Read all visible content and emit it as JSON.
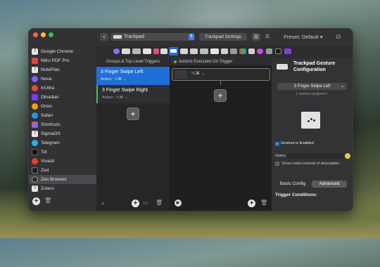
{
  "window": {
    "preset_label": "Preset: Default ▾"
  },
  "toolbar": {
    "back_label": "‹",
    "trigger_type": "Trackpad",
    "trackpad_settings_label": "Trackpad Settings"
  },
  "sidebar": {
    "items": [
      {
        "label": "Google Chrome",
        "color": "#4285f4"
      },
      {
        "label": "Nitro PDF Pro",
        "color": "#d94a3d"
      },
      {
        "label": "NotePlan",
        "color": "#f2f2f2"
      },
      {
        "label": "Nova",
        "color": "#8b5cf6"
      },
      {
        "label": "mUltra",
        "color": "#e5484d"
      },
      {
        "label": "Obsidian",
        "color": "#7c3aed"
      },
      {
        "label": "Orion",
        "color": "#f59e0b"
      },
      {
        "label": "Safari",
        "color": "#1d9bf0"
      },
      {
        "label": "Shortcuts",
        "color": "#ec4899"
      },
      {
        "label": "SigmaOS",
        "color": "#e5e5e5"
      },
      {
        "label": "Telegram",
        "color": "#2aabee"
      },
      {
        "label": "Tot",
        "color": "#111111"
      },
      {
        "label": "Vivaldi",
        "color": "#ef3939"
      },
      {
        "label": "Zed",
        "color": "#1f1f1f"
      },
      {
        "label": "Zen Browser",
        "color": "#2b2b2b"
      },
      {
        "label": "Zotero",
        "color": "#f2f2f2"
      }
    ]
  },
  "triggers": {
    "header": "Groups & Top Level Triggers",
    "items": [
      {
        "name": "3 Finger Swipe Left",
        "action": "Action: ⌥⌘ →"
      },
      {
        "name": "3 Finger Swipe Right",
        "action": "Action: ⌥⌘ ←"
      }
    ],
    "add_label": "+"
  },
  "actions": {
    "header": "Actions Executed On Trigger",
    "items": [
      {
        "text": "⌥⌘ →"
      }
    ],
    "add_label": "+"
  },
  "config": {
    "title": "Trackpad Gesture Configuration",
    "selected_gesture": "3 Finger Swipe Left",
    "assigned_text": "1 actions assigned +",
    "gesture_enabled_label": "Gesture is Enabled",
    "notes_label": "Notes:",
    "show_notes_label": "Show notes instead of description",
    "tab_basic": "Basic Config",
    "tab_advanced": "Advanced",
    "conditions_label": "Trigger Conditions:"
  },
  "colors": {
    "accent": "#1f6fd6",
    "status_green": "#34c759"
  }
}
